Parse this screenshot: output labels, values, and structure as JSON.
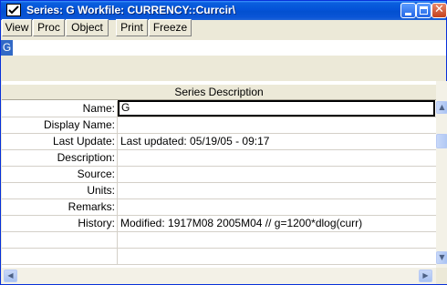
{
  "window": {
    "title": "Series: G   Workfile: CURRENCY::Currcir\\"
  },
  "toolbar": {
    "buttons": [
      "View",
      "Proc",
      "Object",
      "Print",
      "Freeze"
    ]
  },
  "edit_bar": {
    "cell_ref": "G",
    "value": ""
  },
  "grid": {
    "header": "Series Description",
    "rows": [
      {
        "label": "Name:",
        "value": "G"
      },
      {
        "label": "Display Name:",
        "value": ""
      },
      {
        "label": "Last Update:",
        "value": "Last updated: 05/19/05 - 09:17"
      },
      {
        "label": "Description:",
        "value": ""
      },
      {
        "label": "Source:",
        "value": ""
      },
      {
        "label": "Units:",
        "value": ""
      },
      {
        "label": "Remarks:",
        "value": ""
      },
      {
        "label": "History:",
        "value": "Modified: 1917M08 2005M04 // g=1200*dlog(curr)"
      },
      {
        "label": "",
        "value": ""
      },
      {
        "label": "",
        "value": ""
      }
    ]
  },
  "colors": {
    "titlebar": "#0453d8",
    "selection": "#3169c6",
    "chrome": "#ece9d8"
  }
}
